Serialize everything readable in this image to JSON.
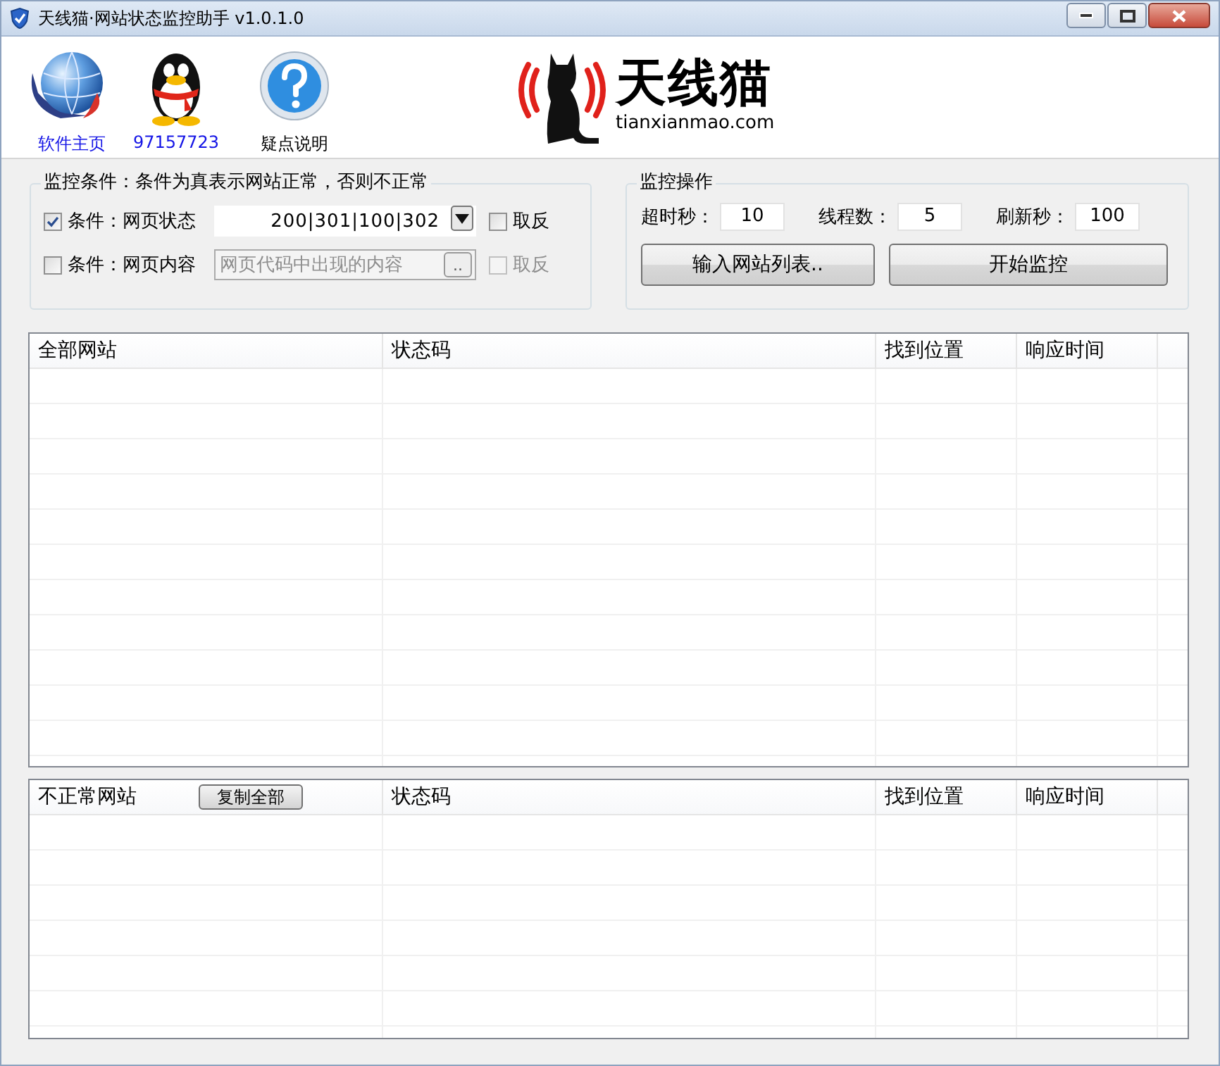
{
  "window": {
    "title": "天线猫·网站状态监控助手 v1.0.1.0"
  },
  "toolbar": {
    "items": [
      {
        "label": "软件主页",
        "kind": "link"
      },
      {
        "label": "97157723",
        "kind": "link"
      },
      {
        "label": "疑点说明",
        "kind": "text"
      }
    ]
  },
  "logo": {
    "name": "天线猫",
    "site": "tianxianmao.com"
  },
  "conditions": {
    "title": "监控条件：条件为真表示网站正常，否则不正常",
    "rows": [
      {
        "kind": "dropdown",
        "checked": true,
        "label": "条件：网页状态",
        "value": "200|301|100|302",
        "invert": {
          "label": "取反",
          "checked": false,
          "disabled": false
        }
      },
      {
        "kind": "browse",
        "checked": false,
        "label": "条件：网页内容",
        "placeholder": "网页代码中出现的内容",
        "button": "..",
        "invert": {
          "label": "取反",
          "checked": false,
          "disabled": true
        }
      }
    ]
  },
  "operations": {
    "title": "监控操作",
    "fields": [
      {
        "label": "超时秒：",
        "value": "10"
      },
      {
        "label": "线程数：",
        "value": "5"
      },
      {
        "label": "刷新秒：",
        "value": "100"
      }
    ],
    "buttons": [
      "输入网站列表..",
      "开始监控"
    ]
  },
  "tables": [
    {
      "columns": [
        "全部网站",
        "状态码",
        "找到位置",
        "响应时间"
      ]
    },
    {
      "columns": [
        "不正常网站",
        "状态码",
        "找到位置",
        "响应时间"
      ],
      "header_button": "复制全部"
    }
  ]
}
